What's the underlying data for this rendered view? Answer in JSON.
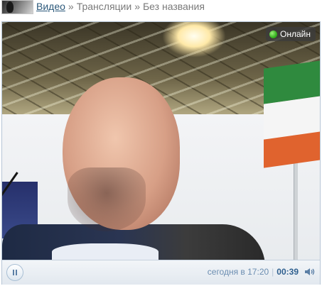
{
  "breadcrumb": {
    "video_link": "Видео",
    "separator": "»",
    "section": "Трансляции",
    "title": "Без названия"
  },
  "player": {
    "status_label": "Онлайн",
    "started_at": "сегодня в 17:20",
    "elapsed": "00:39",
    "controls": {
      "pause_icon": "pause-icon",
      "volume_icon": "volume-icon"
    },
    "colors": {
      "accent": "#2b587a",
      "online": "#36b21f"
    }
  }
}
